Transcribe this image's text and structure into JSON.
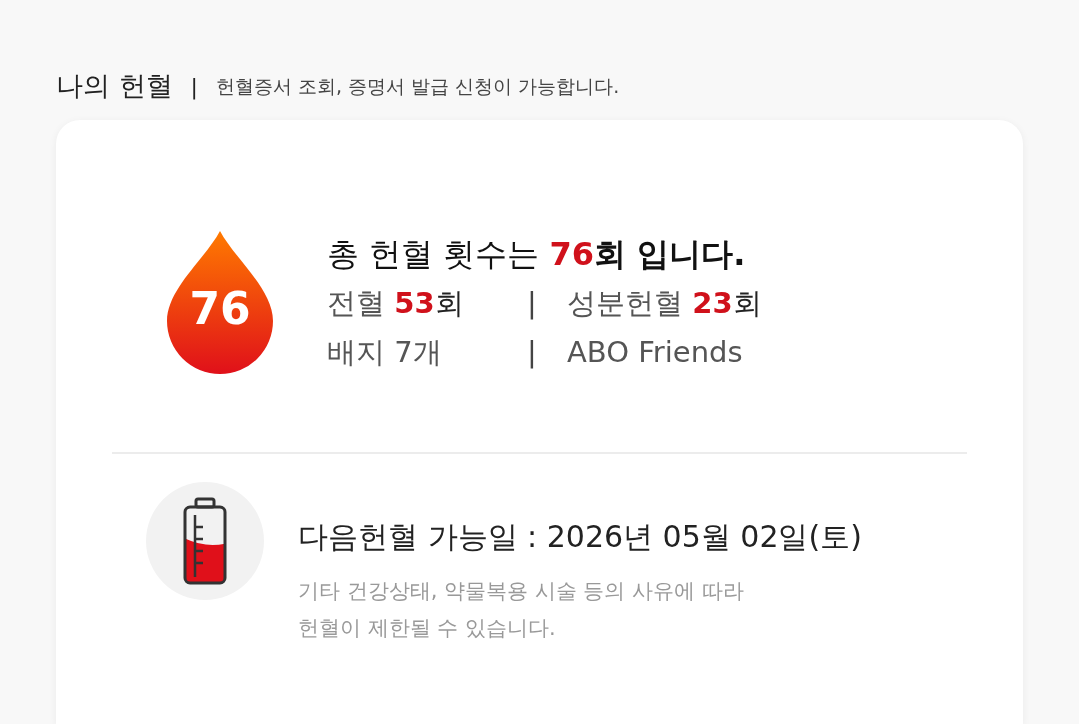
{
  "header": {
    "title": "나의 헌혈",
    "separator": "|",
    "description": "헌혈증서 조회, 증명서 발급 신청이 가능합니다."
  },
  "summary": {
    "badge": "76",
    "prefix": "총 헌혈 횟수는 ",
    "count": "76",
    "suffix": "회 입니다."
  },
  "stats": [
    {
      "label": "전혈 ",
      "count": "53",
      "unit": "회"
    },
    {
      "label": "성분헌혈 ",
      "count": "23",
      "unit": "회"
    },
    {
      "label": "배지 7개"
    },
    {
      "label": "ABO Friends"
    }
  ],
  "separators": [
    "|",
    "|"
  ],
  "next_donation": {
    "title": "다음헌혈 가능일 : 2026년 05월 02일(토)",
    "note_lines": [
      "기타 건강상태, 약물복용 시술 등의 사유에 따라",
      "헌혈이 제한될 수 있습니다."
    ]
  }
}
